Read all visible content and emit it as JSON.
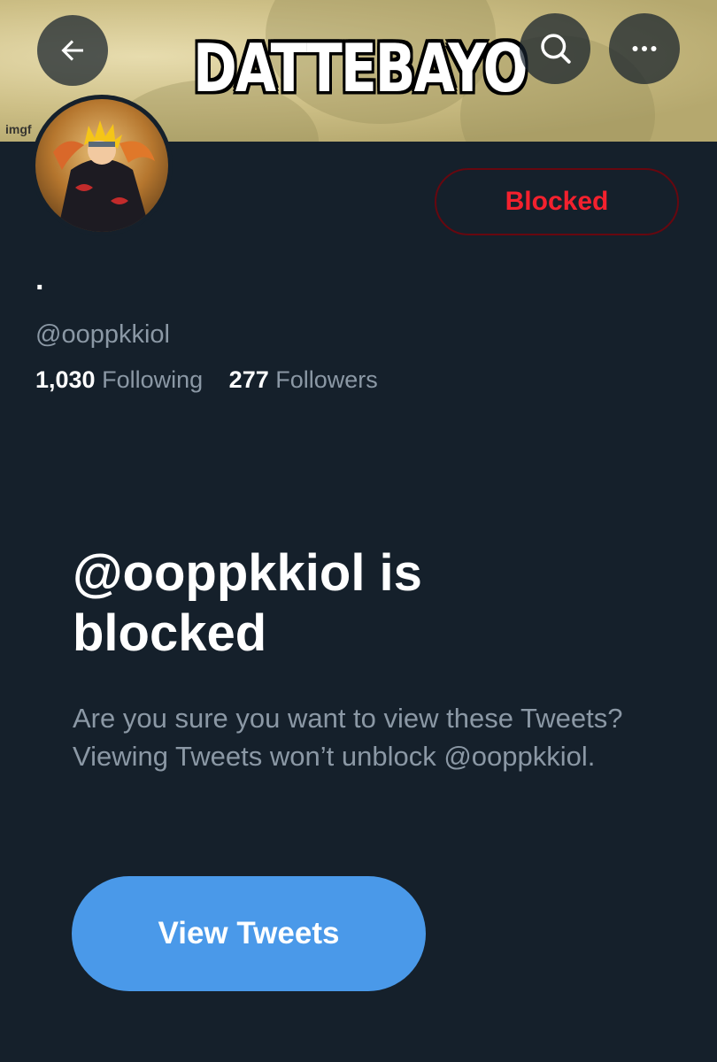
{
  "banner": {
    "caption": "DATTEBAYO",
    "watermark": "imgf"
  },
  "header": {
    "back_icon": "arrow-left-icon",
    "search_icon": "search-icon",
    "more_icon": "more-horizontal-icon"
  },
  "profile": {
    "display_name": "·",
    "handle": "@ooppkkiol",
    "blocked_label": "Blocked",
    "following_count": "1,030",
    "following_label": "Following",
    "followers_count": "277",
    "followers_label": "Followers"
  },
  "blocked_notice": {
    "title": "@ooppkkiol is blocked",
    "description": "Are you sure you want to view these Tweets? Viewing Tweets won’t unblock @ooppkkiol.",
    "view_button_label": "View Tweets"
  },
  "colors": {
    "background": "#15202b",
    "blocked_red": "#f4212e",
    "accent_blue": "#4a99e9",
    "secondary_text": "#8b98a5"
  }
}
